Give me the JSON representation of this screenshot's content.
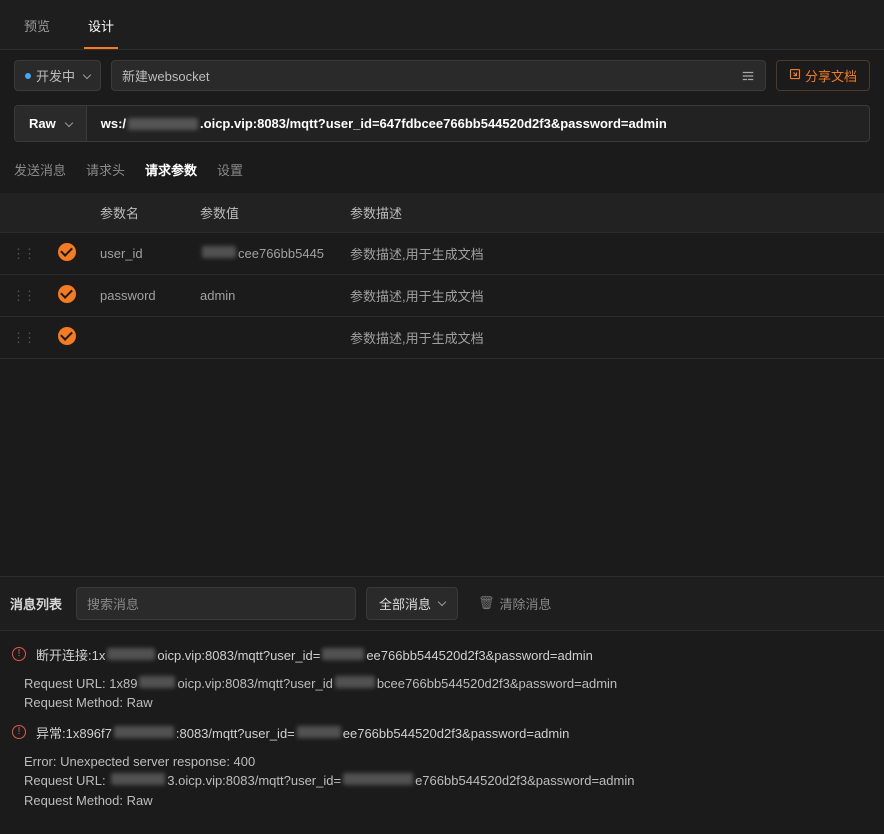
{
  "topTabs": {
    "preview": "预览",
    "design": "设计"
  },
  "status": {
    "label": "开发中"
  },
  "nameInput": "新建websocket",
  "shareBtn": "分享文档",
  "urlBar": {
    "method": "Raw",
    "prefix": "ws:/",
    "mid": ".oicp.vip:8083/mqtt?user_id=647fdbcee766bb544520d2f3&password=admin"
  },
  "secTabs": {
    "send": "发送消息",
    "headers": "请求头",
    "params": "请求参数",
    "settings": "设置"
  },
  "paramsHeader": {
    "name": "参数名",
    "value": "参数值",
    "desc": "参数描述"
  },
  "paramsRows": [
    {
      "name": "user_id",
      "value_suffix": "cee766bb5445",
      "desc": "参数描述,用于生成文档"
    },
    {
      "name": "password",
      "value": "admin",
      "desc": "参数描述,用于生成文档"
    },
    {
      "name": "",
      "value": "",
      "desc": "参数描述,用于生成文档"
    }
  ],
  "msgToolbar": {
    "title": "消息列表",
    "searchPlaceholder": "搜索消息",
    "filter": "全部消息",
    "clear": "清除消息"
  },
  "messages": {
    "row1_prefix": "断开连接:1x",
    "row1_mid": "oicp.vip:8083/mqtt?user_id=",
    "row1_suffix": "ee766bb544520d2f3&password=admin",
    "detail1_line1a": "Request URL: 1x89",
    "detail1_line1b": "oicp.vip:8083/mqtt?user_id",
    "detail1_line1c": "bcee766bb544520d2f3&password=admin",
    "detail1_line2": "Request Method: Raw",
    "row2_prefix": "异常:1x896f7",
    "row2_mid": ":8083/mqtt?user_id=",
    "row2_suffix": "ee766bb544520d2f3&password=admin",
    "detail2_line1": "Error: Unexpected server response: 400",
    "detail2_line2a": "Request URL: ",
    "detail2_line2b": "3.oicp.vip:8083/mqtt?user_id=",
    "detail2_line2c": "e766bb544520d2f3&password=admin",
    "detail2_line3": "Request Method: Raw"
  }
}
